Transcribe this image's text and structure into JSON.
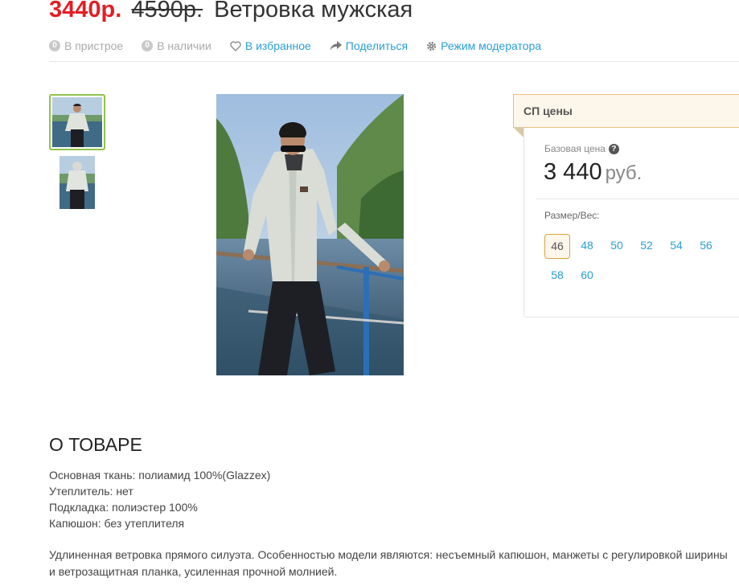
{
  "header": {
    "price_new": "3440р.",
    "price_old": "4590р.",
    "product_name": "Ветровка мужская"
  },
  "actions": {
    "pristroy_count": "0",
    "pristroy_label": "В пристрое",
    "stock_count": "0",
    "stock_label": "В наличии",
    "favorite_label": "В избранное",
    "share_label": "Поделиться",
    "moderator_label": "Режим модератора"
  },
  "prices_panel": {
    "title": "СП цены",
    "base_label": "Базовая цена",
    "help_glyph": "?",
    "base_value": "3 440",
    "base_currency": "руб.",
    "size_label": "Размер/Вес:",
    "sizes": [
      "46",
      "48",
      "50",
      "52",
      "54",
      "56",
      "58",
      "60"
    ],
    "selected_size": "46"
  },
  "about": {
    "title": "О ТОВАРЕ",
    "props": [
      "Основная ткань: полиамид 100%(Glazzex)",
      "Утеплитель: нет",
      "Подкладка: полиэстер 100%",
      "Капюшон: без утеплителя"
    ],
    "description": "Удлиненная ветровка прямого силуэта. Особенностью модели являются: несъемный капюшон, манжеты с регулировкой ширины и ветрозащитная планка, усиленная прочной молнией."
  },
  "colors": {
    "accent_red": "#e31e24",
    "link_blue": "#2a9fd6",
    "thumb_border_green": "#8fc24b",
    "panel_border_orange": "#ebc07c"
  },
  "icons": [
    "heart-icon",
    "share-arrow-icon",
    "gear-icon",
    "help-icon"
  ]
}
